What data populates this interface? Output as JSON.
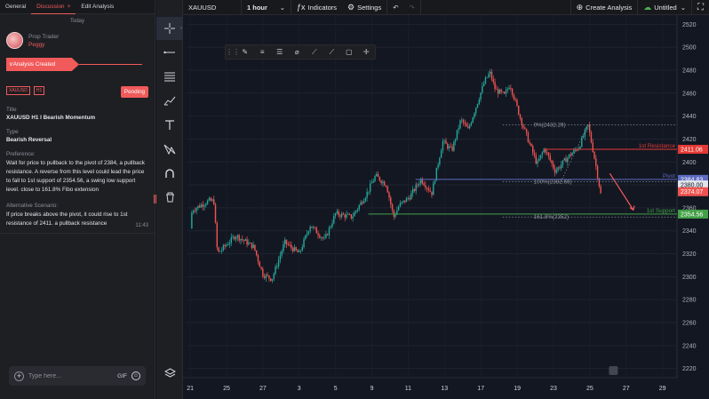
{
  "tabs": [
    "General",
    "Discussion",
    "Edit Analysis"
  ],
  "tab_close": "×",
  "date_divider": "Today",
  "author": {
    "role": "Prop Trader",
    "name": "Peggy"
  },
  "status": {
    "label": "Analysis Created",
    "arrow": "∨"
  },
  "tags": [
    "XAUUSD",
    "H1"
  ],
  "pending_label": "Pending",
  "title_label": "Title",
  "title_value": "XAUUSD H1 I Bearish Momentum",
  "type_label": "Type",
  "type_value": "Bearish Reversal",
  "preference_label": "Preference:",
  "preference_text": "Wait for price to pullback to the pivot of 2384, a pullback resistance. A reverse from this level could lead the price to fall to 1st support of 2354.56, a swing low support level. close to 161.8% Fibo extension",
  "alt_label": "Alternative Scenario:",
  "alt_text": "If price breaks above the pivot, it could rise to 1st resistance of 2411. a pullback resistance",
  "message_time": "11:43",
  "input": {
    "placeholder": "Type here...",
    "value": "",
    "gif": "GIF"
  },
  "topbar": {
    "symbol": "XAUUSD",
    "interval": "1 hour",
    "indicators": "Indicators",
    "settings": "Settings",
    "create_analysis": "Create Analysis",
    "layout_name": "Untitled"
  },
  "colors": {
    "accent": "#f15a5a",
    "bg": "#131722",
    "up": "#26a69a",
    "down": "#ef5350",
    "resistance": "#e53935",
    "pivot": "#5c6bc0",
    "support": "#43a047"
  },
  "icons": {
    "crosshair": "crosshair-icon",
    "trend_line": "trend-line-icon",
    "fib": "fib-icon",
    "brush": "brush-icon",
    "text": "text-icon",
    "pattern": "pattern-icon",
    "magnet": "magnet-icon",
    "trash": "trash-icon",
    "layers": "layers-icon",
    "fullscreen": "fullscreen-icon"
  },
  "chart_data": {
    "type": "candlestick",
    "symbol": "XAUUSD",
    "timeframe": "H1",
    "ylim": [
      2212,
      2528
    ],
    "y_ticks": [
      2220,
      2240,
      2260,
      2280,
      2300,
      2320,
      2340,
      2360,
      2380,
      2400,
      2420,
      2440,
      2460,
      2480,
      2500,
      2520
    ],
    "x_ticks": [
      "21",
      "25",
      "27",
      "3",
      "5",
      "9",
      "11",
      "13",
      "17",
      "19",
      "23",
      "25",
      "27",
      "29"
    ],
    "price_path": [
      [
        0,
        2342
      ],
      [
        0.1,
        2358
      ],
      [
        1.0,
        2366
      ],
      [
        1.3,
        2366
      ],
      [
        1.5,
        2320
      ],
      [
        2.5,
        2336
      ],
      [
        3.5,
        2326
      ],
      [
        4.0,
        2302
      ],
      [
        4.5,
        2298
      ],
      [
        5.2,
        2330
      ],
      [
        6.0,
        2320
      ],
      [
        6.6,
        2345
      ],
      [
        7.4,
        2332
      ],
      [
        8.0,
        2355
      ],
      [
        8.9,
        2352
      ],
      [
        9.7,
        2372
      ],
      [
        10.2,
        2388
      ],
      [
        10.8,
        2380
      ],
      [
        11.2,
        2352
      ],
      [
        11.5,
        2362
      ],
      [
        12.1,
        2370
      ],
      [
        12.7,
        2385
      ],
      [
        13.3,
        2373
      ],
      [
        13.9,
        2418
      ],
      [
        14.4,
        2410
      ],
      [
        14.9,
        2437
      ],
      [
        15.3,
        2428
      ],
      [
        16.2,
        2470
      ],
      [
        16.5,
        2478
      ],
      [
        16.8,
        2463
      ],
      [
        17.3,
        2458
      ],
      [
        17.6,
        2468
      ],
      [
        18.2,
        2437
      ],
      [
        18.7,
        2415
      ],
      [
        19.1,
        2398
      ],
      [
        19.5,
        2412
      ],
      [
        20.1,
        2392
      ],
      [
        20.9,
        2406
      ],
      [
        21.4,
        2413
      ],
      [
        21.9,
        2432
      ],
      [
        22.3,
        2400
      ],
      [
        22.6,
        2372
      ]
    ],
    "levels": [
      {
        "price": 2432.26,
        "label": "0%(2432.26)",
        "style": "dotted"
      },
      {
        "price": 2411.06,
        "label": "1st Resistance",
        "badge": "2411.06",
        "color": "#e53935"
      },
      {
        "price": 2384.83,
        "label": "Pivot",
        "badge": "2384.83",
        "color": "#5c6bc0"
      },
      {
        "price": 2382.66,
        "label": "100%(2382.66)",
        "style": "dotted"
      },
      {
        "price": 2354.56,
        "label": "1st Support",
        "badge": "2354.56",
        "color": "#43a047"
      },
      {
        "price": 2352,
        "label": "161.8%(2352)",
        "style": "dotted"
      }
    ],
    "current_price_badges": [
      {
        "text": "2380.00",
        "color": "#e0e3eb",
        "price": 2380
      },
      {
        "text": "2374.07",
        "color": "#ef5350",
        "price": 2374.07
      }
    ]
  }
}
